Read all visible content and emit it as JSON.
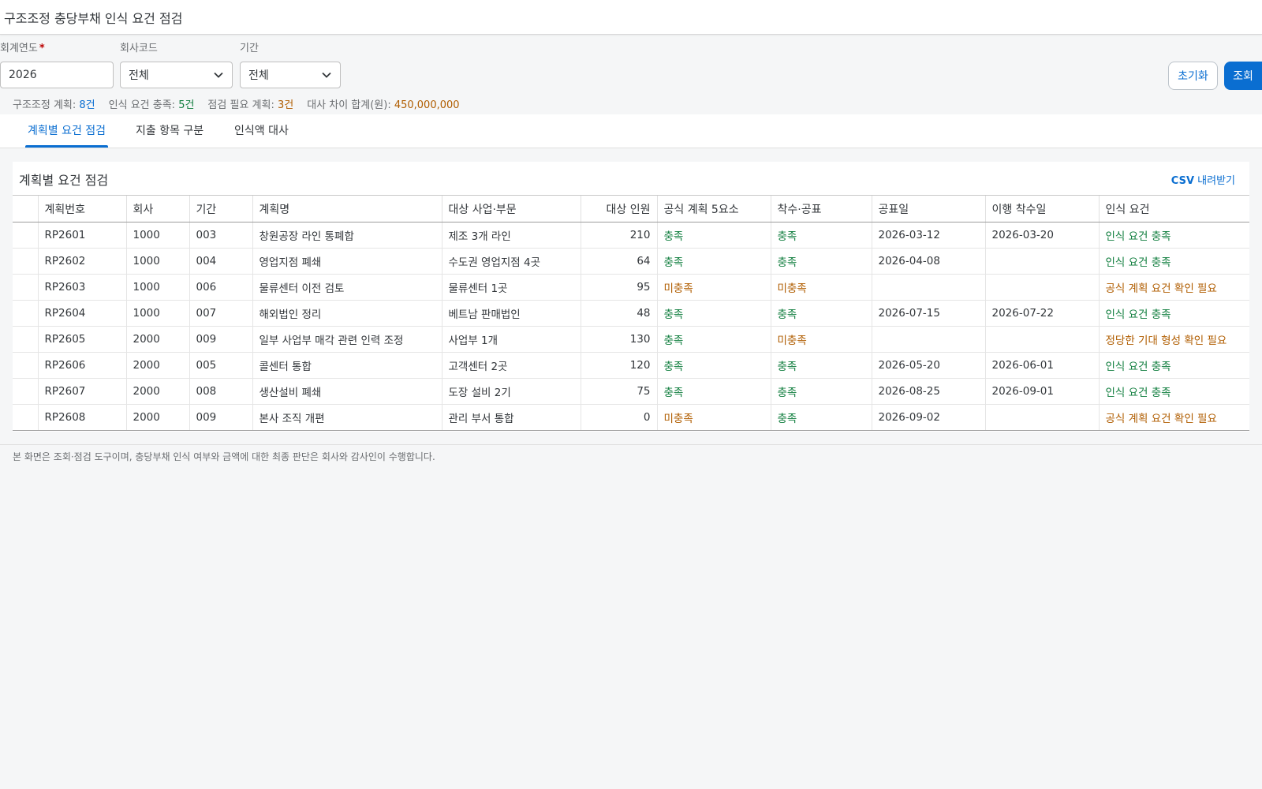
{
  "header": {
    "title": "구조조정 충당부채 인식 요건 점검"
  },
  "filters": {
    "fiscal_year": {
      "label": "회계연도",
      "required_mark": "*",
      "value": "2026"
    },
    "company": {
      "label": "회사코드",
      "value": "전체"
    },
    "period": {
      "label": "기간",
      "value": "전체"
    }
  },
  "buttons": {
    "reset": "초기화",
    "search": "조회"
  },
  "summary": {
    "plans_label": "구조조정 계획: ",
    "plans_value": "8건",
    "met_label": "인식 요건 충족: ",
    "met_value": "5건",
    "review_label": "점검 필요 계획: ",
    "review_value": "3건",
    "diff_label": "대사 차이 합계(원): ",
    "diff_value": "450,000,000"
  },
  "tabs": [
    "계획별 요건 점검",
    "지출 항목 구분",
    "인식액 대사"
  ],
  "panel": {
    "title": "계획별 요건 점검",
    "csv": "CSV 내려받기"
  },
  "table": {
    "columns": [
      "",
      "계획번호",
      "회사",
      "기간",
      "계획명",
      "대상 사업·부문",
      "대상 인원",
      "공식 계획 5요소",
      "착수·공표",
      "공표일",
      "이행 착수일",
      "인식 요건"
    ],
    "rows": [
      {
        "plan_no": "RP2601",
        "company": "1000",
        "period": "003",
        "name": "창원공장 라인 통폐합",
        "target": "제조 3개 라인",
        "headcount": "210",
        "formal": "충족",
        "announce": "충족",
        "announce_date": "2026-03-12",
        "start_date": "2026-03-20",
        "status": "인식 요건 충족"
      },
      {
        "plan_no": "RP2602",
        "company": "1000",
        "period": "004",
        "name": "영업지점 폐쇄",
        "target": "수도권 영업지점 4곳",
        "headcount": "64",
        "formal": "충족",
        "announce": "충족",
        "announce_date": "2026-04-08",
        "start_date": "",
        "status": "인식 요건 충족"
      },
      {
        "plan_no": "RP2603",
        "company": "1000",
        "period": "006",
        "name": "물류센터 이전 검토",
        "target": "물류센터 1곳",
        "headcount": "95",
        "formal": "미충족",
        "announce": "미충족",
        "announce_date": "",
        "start_date": "",
        "status": "공식 계획 요건 확인 필요"
      },
      {
        "plan_no": "RP2604",
        "company": "1000",
        "period": "007",
        "name": "해외법인 정리",
        "target": "베트남 판매법인",
        "headcount": "48",
        "formal": "충족",
        "announce": "충족",
        "announce_date": "2026-07-15",
        "start_date": "2026-07-22",
        "status": "인식 요건 충족"
      },
      {
        "plan_no": "RP2605",
        "company": "2000",
        "period": "009",
        "name": "일부 사업부 매각 관련 인력 조정",
        "target": "사업부 1개",
        "headcount": "130",
        "formal": "충족",
        "announce": "미충족",
        "announce_date": "",
        "start_date": "",
        "status": "정당한 기대 형성 확인 필요"
      },
      {
        "plan_no": "RP2606",
        "company": "2000",
        "period": "005",
        "name": "콜센터 통합",
        "target": "고객센터 2곳",
        "headcount": "120",
        "formal": "충족",
        "announce": "충족",
        "announce_date": "2026-05-20",
        "start_date": "2026-06-01",
        "status": "인식 요건 충족"
      },
      {
        "plan_no": "RP2607",
        "company": "2000",
        "period": "008",
        "name": "생산설비 폐쇄",
        "target": "도장 설비 2기",
        "headcount": "75",
        "formal": "충족",
        "announce": "충족",
        "announce_date": "2026-08-25",
        "start_date": "2026-09-01",
        "status": "인식 요건 충족"
      },
      {
        "plan_no": "RP2608",
        "company": "2000",
        "period": "009",
        "name": "본사 조직 개편",
        "target": "관리 부서 통합",
        "headcount": "0",
        "formal": "미충족",
        "announce": "충족",
        "announce_date": "2026-09-02",
        "start_date": "",
        "status": "공식 계획 요건 확인 필요"
      }
    ]
  },
  "footer": {
    "note": "본 화면은 조회·점검 도구이며, 충당부채 인식 여부와 금액에 대한 최종 판단은 회사와 감사인이 수행합니다."
  },
  "colors": {
    "accent": "#0a6ed1",
    "positive": "#107e3e",
    "warning": "#b05d00",
    "required": "#bb0000"
  },
  "icons": {
    "dropdown": "chevron-down-icon"
  }
}
